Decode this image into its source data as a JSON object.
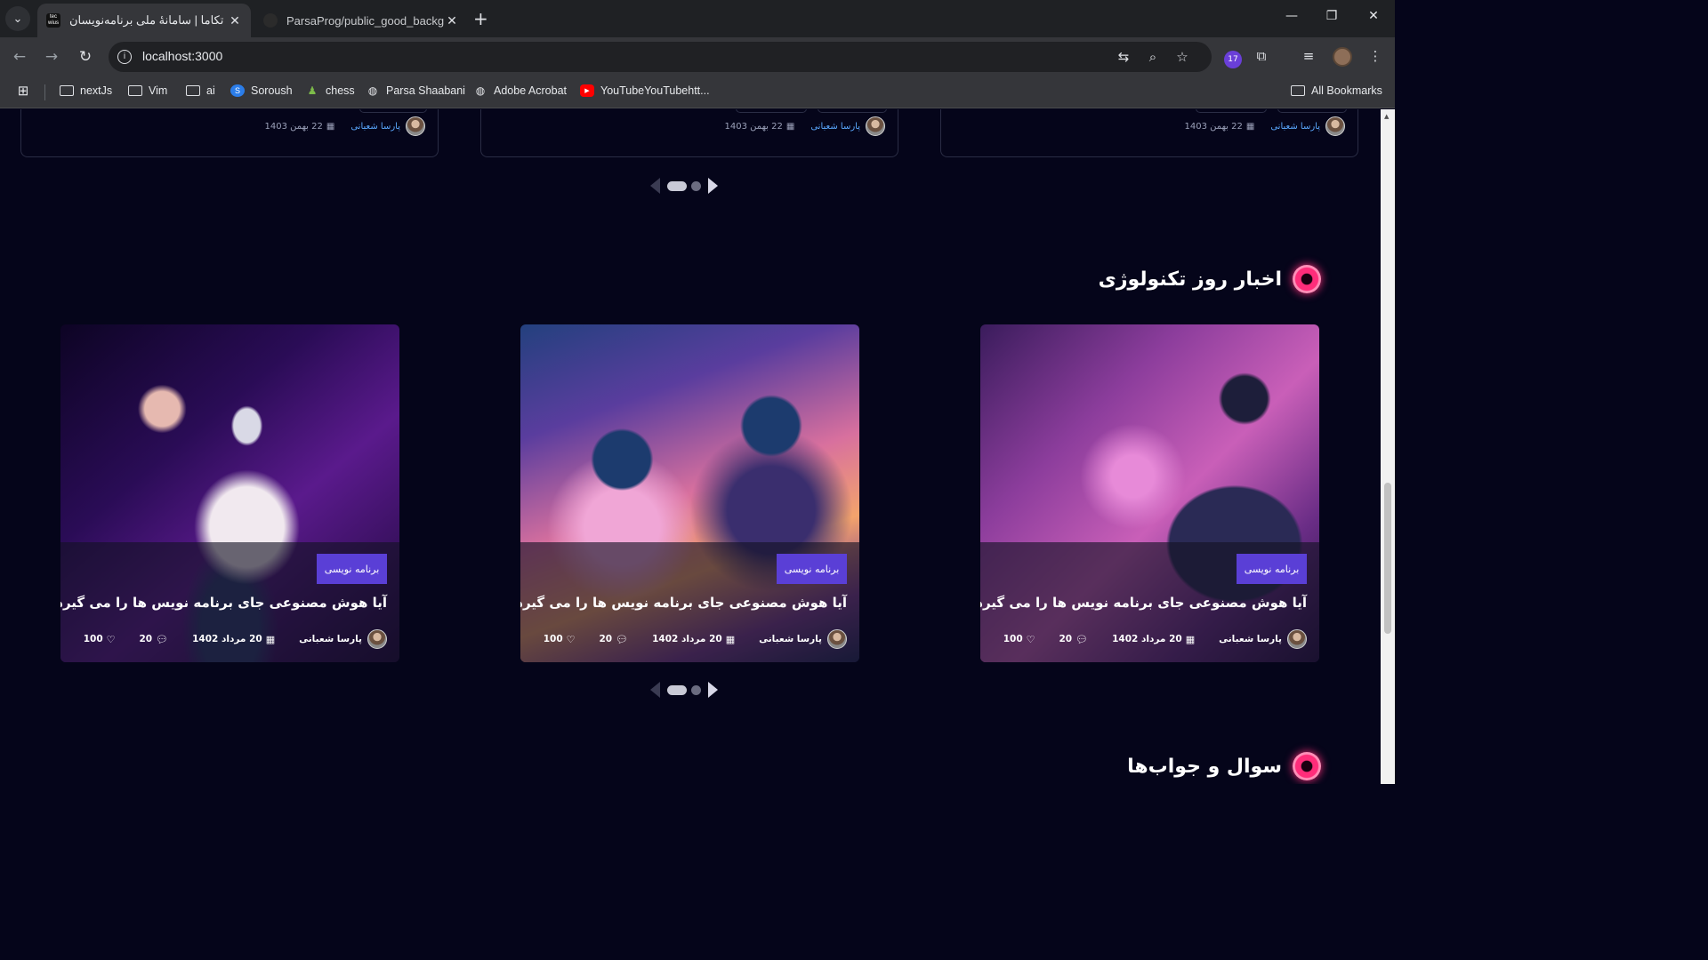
{
  "browser": {
    "tabs": [
      {
        "title": "تکاما | سامانهٔ ملی برنامه‌نویسان",
        "favicon": "tec wius",
        "active": true
      },
      {
        "title": "ParsaProg/public_good_backgr",
        "favicon": "github-icon",
        "active": false
      }
    ],
    "address": "localhost:3000",
    "extension_badge": "17",
    "bookmarks": [
      {
        "label": "nextJs",
        "icon": "folder-icon"
      },
      {
        "label": "Vim",
        "icon": "folder-icon"
      },
      {
        "label": "ai",
        "icon": "folder-icon"
      },
      {
        "label": "Soroush",
        "icon": "soroush-icon"
      },
      {
        "label": "chess",
        "icon": "chess-pawn-icon"
      },
      {
        "label": "Parsa Shaabani",
        "icon": "globe-icon"
      },
      {
        "label": "Adobe Acrobat",
        "icon": "globe-icon"
      },
      {
        "label": "YouTubeYouTubehtt...",
        "icon": "youtube-icon"
      }
    ],
    "all_bookmarks": "All Bookmarks"
  },
  "top_cards": [
    {
      "author": "پارسا شعبانی",
      "date": "22 بهمن 1403"
    },
    {
      "author": "پارسا شعبانی",
      "date": "22 بهمن 1403"
    },
    {
      "author": "پارسا شعبانی",
      "date": "22 بهمن 1403"
    }
  ],
  "news_section": {
    "title": "اخبار روز تکنولوژی",
    "cards": [
      {
        "badge": "برنامه نویسی",
        "title": "آیا هوش مصنوعی جای برنامه نویس ها را می گیرد؟",
        "author": "پارسا شعبانی",
        "date": "20 مرداد 1402",
        "comments": "20",
        "likes": "100"
      },
      {
        "badge": "برنامه نویسی",
        "title": "آیا هوش مصنوعی جای برنامه نویس ها را می گیرد؟",
        "author": "پارسا شعبانی",
        "date": "20 مرداد 1402",
        "comments": "20",
        "likes": "100"
      },
      {
        "badge": "برنامه نویسی",
        "title": "آیا هوش مصنوعی جای برنامه نویس ها را می گیرد؟",
        "author": "پارسا شعبانی",
        "date": "20 مرداد 1402",
        "comments": "20",
        "likes": "100"
      }
    ]
  },
  "qa_section": {
    "title": "سوال و جواب‌ها"
  },
  "colors": {
    "page_bg": "#05051a",
    "badge": "#5a3fd6",
    "accent_pink": "#ff2d7a",
    "author_link": "#5aa8ff"
  }
}
